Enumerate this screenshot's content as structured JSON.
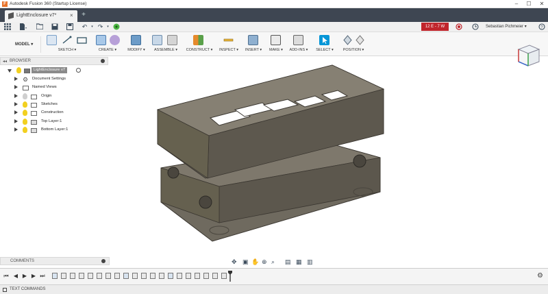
{
  "window": {
    "title": "Autodesk Fusion 360 (Startup License)",
    "app_icon": "F"
  },
  "tab": {
    "label": "LightEnclosure v7*"
  },
  "quickbar": {
    "cloud_badge": "12 E - 7 W",
    "user": "Sebastian Pichmeier ▾"
  },
  "toolbar": {
    "workspace": "MODEL ▾",
    "groups": [
      "SKETCH ▾",
      "CREATE ▾",
      "MODIFY ▾",
      "ASSEMBLE ▾",
      "CONSTRUCT ▾",
      "INSPECT ▾",
      "INSERT ▾",
      "MAKE ▾",
      "ADD-INS ▾",
      "SELECT ▾",
      "POSITION ▾"
    ]
  },
  "browser": {
    "title": "BROWSER",
    "root": "LightEnclosure v7",
    "items": [
      "Document Settings",
      "Named Views",
      "Origin",
      "Sketches",
      "Construction",
      "Top Layer:1",
      "Bottom Layer:1"
    ]
  },
  "comments": {
    "title": "COMMENTS"
  },
  "textcommands": {
    "title": "TEXT COMMANDS"
  },
  "colors": {
    "accent": "#0696d7",
    "badge": "#c0252c",
    "tabbar": "#3e4652",
    "model": "#6f6a5f"
  },
  "icons": {
    "settings": "gear-icon",
    "timeline_settings": "gear-icon"
  }
}
